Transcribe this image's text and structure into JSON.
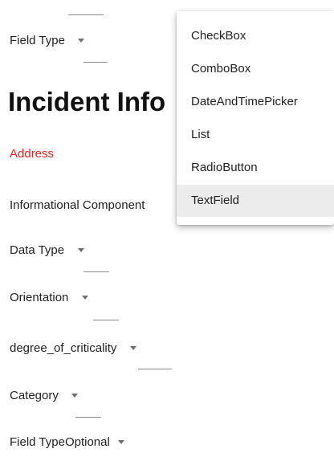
{
  "fields": {
    "field_type_top": "Field Type",
    "section_title": "Incident Info",
    "address": "Address",
    "informational_component": "Informational Component",
    "data_type": "Data Type",
    "orientation": "Orientation",
    "degree_of_criticality": "degree_of_criticality",
    "category": "Category",
    "field_type_bottom": "Field Type",
    "field_type_bottom_value": "Optional"
  },
  "menu": {
    "items": [
      {
        "label": "CheckBox"
      },
      {
        "label": "ComboBox"
      },
      {
        "label": "DateAndTimePicker"
      },
      {
        "label": "List"
      },
      {
        "label": "RadioButton"
      },
      {
        "label": "TextField",
        "highlighted": true
      }
    ]
  },
  "colors": {
    "required_label": "#ff1a1a",
    "menu_hover": "#ececec"
  }
}
